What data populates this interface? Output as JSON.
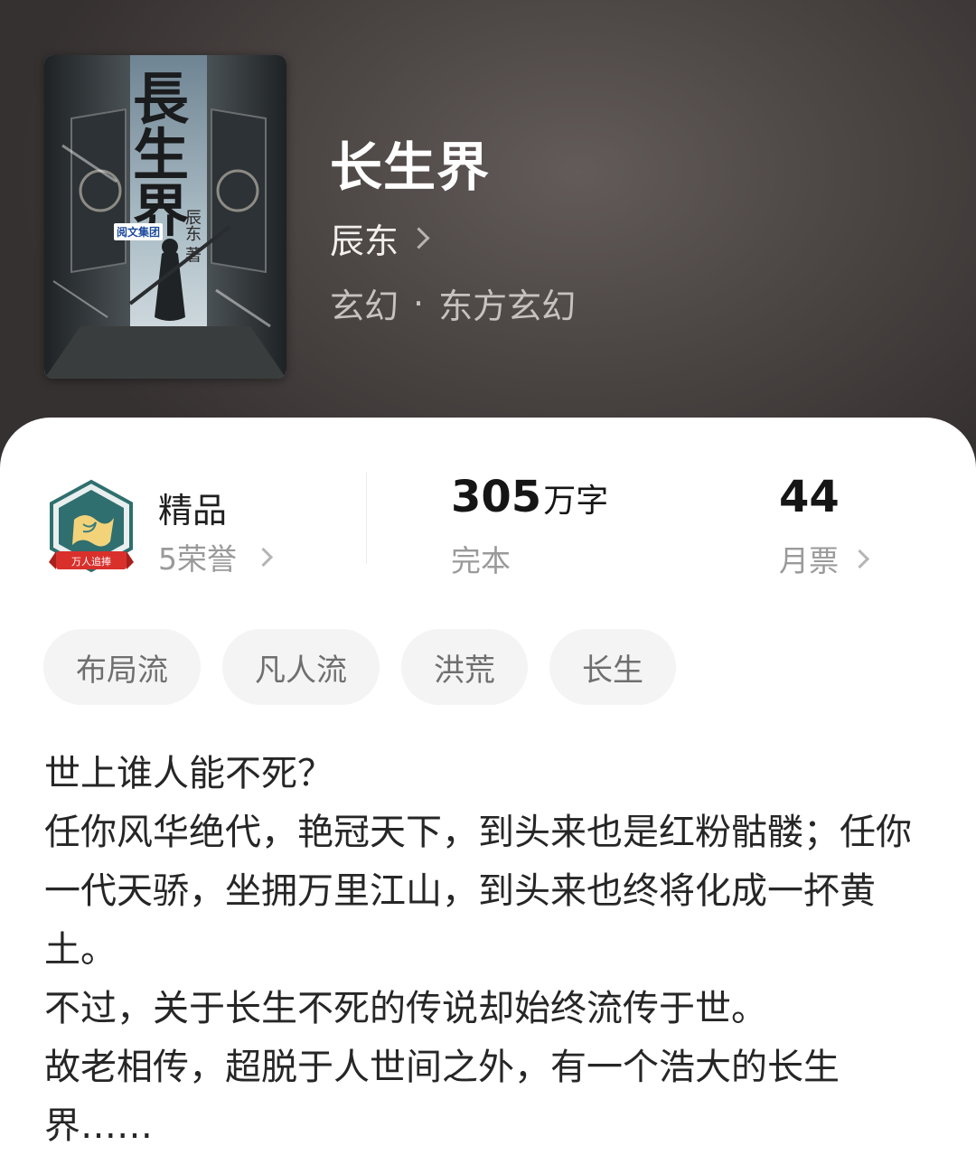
{
  "book": {
    "title": "长生界",
    "author": "辰东",
    "category": "玄幻",
    "subcategory": "东方玄幻",
    "separator": "·"
  },
  "cover": {
    "title_text": "長生界",
    "author_text": "辰东 著",
    "publisher_text": "阅文集团"
  },
  "stats": {
    "quality_label": "精品",
    "honors": "5荣誉",
    "word_count": "305",
    "word_unit": "万字",
    "status": "完本",
    "monthly_tickets": "44",
    "monthly_tickets_label": "月票"
  },
  "badge": {
    "ribbon_text": "万人追捧"
  },
  "tags": [
    "布局流",
    "凡人流",
    "洪荒",
    "长生"
  ],
  "synopsis": [
    "世上谁人能不死？",
    "任你风华绝代，艳冠天下，到头来也是红粉骷髅；任你一代天骄，坐拥万里江山，到头来也终将化成一抔黄土。",
    "不过，关于长生不死的传说却始终流传于世。",
    "故老相传，超脱于人世间之外，有一个浩大的长生界……"
  ],
  "colors": {
    "header_bg": "#4d4745",
    "tag_bg": "#f4f4f4",
    "badge_teal": "#2f6f6f",
    "badge_red": "#d9302c"
  }
}
